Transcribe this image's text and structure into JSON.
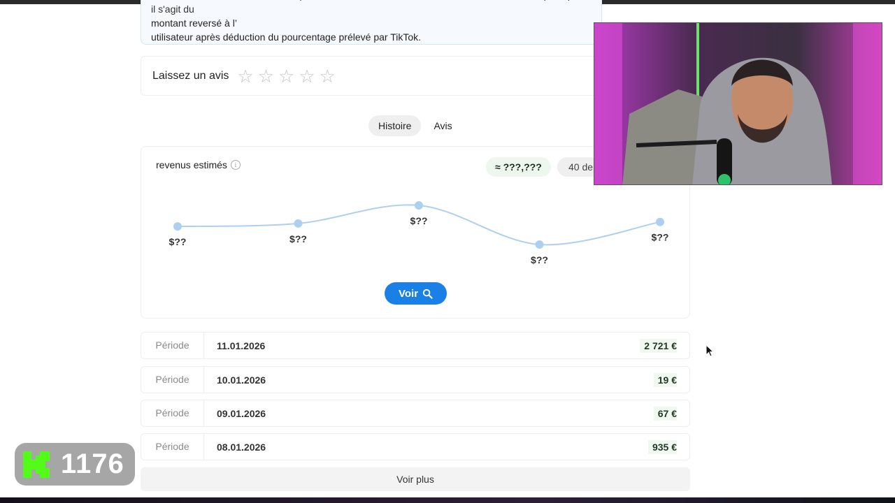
{
  "info_box": {
    "line1": "Estimation des revenus de TikTok provenant des dons collectés via les diffusions en direct publiques ; il s'agit du",
    "line2": "montant reversé à l’",
    "line3": "utilisateur après déduction du pourcentage prélevé par TikTok."
  },
  "review": {
    "label": "Laissez un avis",
    "rating": 0,
    "max_rating": 5
  },
  "tabs": [
    {
      "label": "Histoire",
      "active": true
    },
    {
      "label": "Avis",
      "active": false
    }
  ],
  "chart_card": {
    "title": "revenus estimés",
    "approx_value": "≈ ???,???",
    "days_label": "40 de",
    "button_label": "Voir"
  },
  "chart_data": {
    "type": "line",
    "x": [
      1,
      2,
      3,
      4,
      5
    ],
    "values": [
      0.8,
      1.0,
      2.2,
      -0.4,
      1.1
    ],
    "labels": [
      "$??",
      "$??",
      "$??",
      "$??",
      "$??"
    ],
    "series_color": "#aed0f0",
    "grid": false
  },
  "periods": [
    {
      "label": "Période",
      "date": "11.01.2026",
      "value": "2 721 €"
    },
    {
      "label": "Période",
      "date": "10.01.2026",
      "value": "19 €"
    },
    {
      "label": "Période",
      "date": "09.01.2026",
      "value": "67 €"
    },
    {
      "label": "Période",
      "date": "08.01.2026",
      "value": "935 €"
    }
  ],
  "voir_plus": "Voir plus",
  "overlay": {
    "counter": "1176",
    "accent": "#5cd65c"
  }
}
